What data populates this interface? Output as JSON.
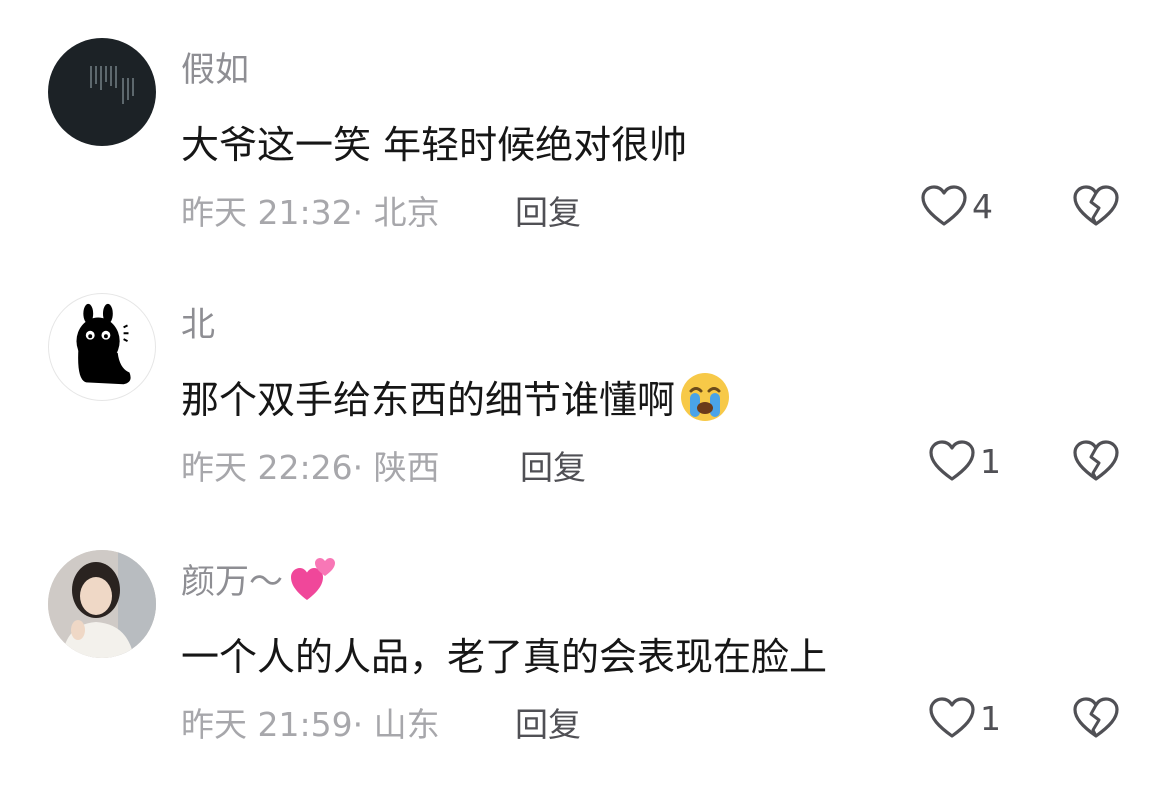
{
  "comments": [
    {
      "username": "假如",
      "text": "大爷这一笑 年轻时候绝对很帅",
      "time": "昨天 21:32",
      "location": "北京",
      "reply_label": "回复",
      "likes": "4"
    },
    {
      "username": "北",
      "text": "那个双手给东西的细节谁懂啊",
      "time": "昨天 22:26",
      "location": "陕西",
      "reply_label": "回复",
      "likes": "1"
    },
    {
      "username": "颜万～",
      "text": "一个人的人品，老了真的会表现在脸上",
      "time": "昨天 21:59",
      "location": "山东",
      "reply_label": "回复",
      "likes": "1"
    }
  ],
  "meta_separator": "· ",
  "icons": {
    "like": "heart-outline-icon",
    "dislike": "broken-heart-icon",
    "emoji_cry": "loudly-crying-face-emoji",
    "emoji_hearts": "two-hearts-emoji"
  },
  "colors": {
    "text_primary": "#161616",
    "text_secondary": "#8e8e93",
    "text_meta": "#a7a7ab",
    "icon": "#505055"
  }
}
